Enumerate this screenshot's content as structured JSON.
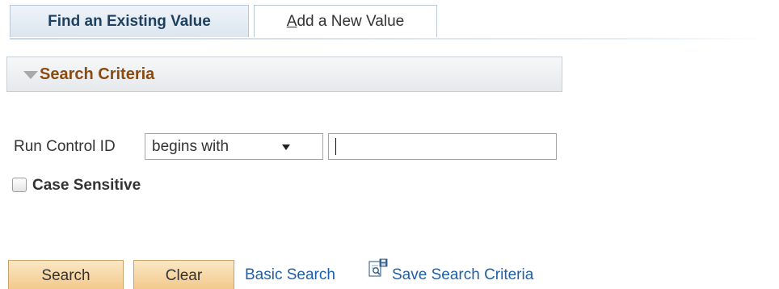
{
  "tabs": [
    {
      "label": "Find an Existing Value",
      "active": true
    },
    {
      "label_accesskey": "A",
      "label_rest": "dd a New Value",
      "active": false
    }
  ],
  "search_criteria": {
    "title": "Search Criteria",
    "expanded": true
  },
  "run_control": {
    "label": "Run Control ID",
    "operator": "begins with",
    "value": ""
  },
  "case_sensitive": {
    "label": "Case Sensitive",
    "checked": false
  },
  "actions": {
    "search_label": "Search",
    "clear_label": "Clear",
    "basic_search_label": "Basic Search",
    "save_search_label": "Save Search Criteria",
    "save_search_icon": "save-search-icon"
  },
  "colors": {
    "section_title": "#8a4b12",
    "link": "#1f5fa8",
    "button_top": "#fbe7c4",
    "button_bottom": "#f3c98d"
  }
}
